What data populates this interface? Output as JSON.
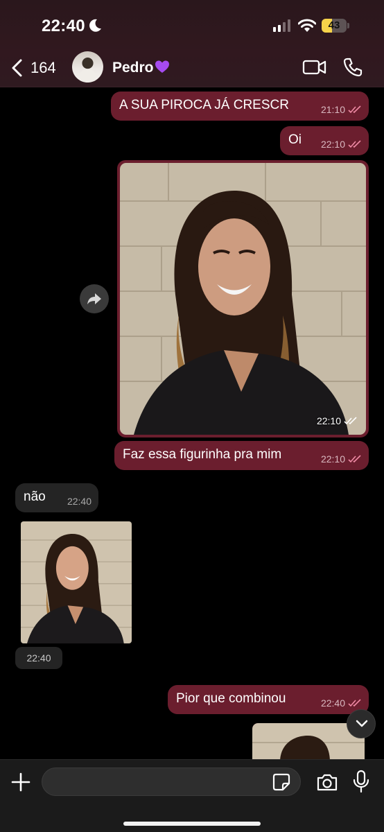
{
  "status_bar": {
    "time": "22:40",
    "battery": "43",
    "battery_level": 0.43
  },
  "header": {
    "back_count": "164",
    "contact_name": "Pedro"
  },
  "messages": [
    {
      "direction": "outgoing",
      "type": "text",
      "text": "A SUA PIROCA JÁ CRESCR",
      "time": "21:10"
    },
    {
      "direction": "outgoing",
      "type": "text",
      "text": "Oi",
      "time": "22:10"
    },
    {
      "direction": "outgoing",
      "type": "image",
      "time": "22:10"
    },
    {
      "direction": "outgoing",
      "type": "text",
      "text": "Faz essa figurinha pra mim",
      "time": "22:10"
    },
    {
      "direction": "incoming",
      "type": "text",
      "text": "não",
      "time": "22:40"
    },
    {
      "direction": "incoming",
      "type": "sticker",
      "time": "22:40"
    },
    {
      "direction": "outgoing",
      "type": "text",
      "text": "Pior que combinou",
      "time": "22:40"
    }
  ],
  "colors": {
    "outgoing_bubble": "#6b1e2e",
    "incoming_bubble": "#242424",
    "header_background": "#2f1a20",
    "background": "#000000"
  },
  "icons": [
    "moon-icon",
    "signal-icon",
    "wifi-icon",
    "back-chevron-icon",
    "purple-heart-icon",
    "video-call-icon",
    "phone-icon",
    "double-check-icon",
    "forward-icon",
    "chevron-down-icon",
    "plus-icon",
    "sticker-icon",
    "camera-icon",
    "microphone-icon"
  ]
}
